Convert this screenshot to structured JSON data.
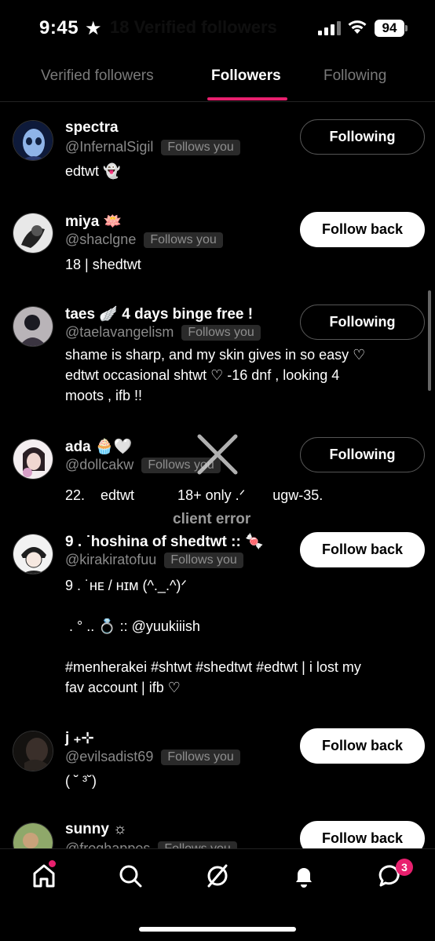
{
  "status_bar": {
    "time": "9:45",
    "battery": "94"
  },
  "header_ghost": "18 Verified followers",
  "tabs": [
    {
      "label": "Verified followers"
    },
    {
      "label": "Followers"
    },
    {
      "label": "Following"
    }
  ],
  "followers": [
    {
      "name": "spectra",
      "handle": "@InfernalSigil",
      "badge": "Follows you",
      "bio": "edtwt 👻",
      "button": "Following"
    },
    {
      "name": "miya 🪷",
      "handle": "@shaclgne",
      "badge": "Follows you",
      "bio": "18 | shedtwt",
      "button": "Follow back"
    },
    {
      "name": "taes 🪽 4 days binge free !",
      "handle": "@taelavangelism",
      "badge": "Follows you",
      "bio": "shame is sharp, and my skin gives in so easy ♡\nedtwt occasional shtwt ♡ -16 dnf , looking 4\nmoots , ifb !!",
      "button": "Following"
    },
    {
      "name": "ada 🧁🤍",
      "handle": "@dollcakw",
      "badge": "Follows you",
      "bio": "22.    edtwt           18+ only .ᐟ       ugw-35.",
      "button": "Following"
    },
    {
      "name": "9 . ˙hoshina of shedtwt :: 🍬",
      "handle": "@kirakiratofuu",
      "badge": "Follows you",
      "bio": "9 . ˙ʜᴇ / ʜɪᴍ (^._.^)ᐟ\n\n . ° .. 💍 :: @yuukiiish\n\n#menherakei #shtwt #shedtwt #edtwt | i lost my\nfav account | ifb ♡",
      "button": "Follow back"
    },
    {
      "name": "j ₊⊹",
      "handle": "@evilsadist69",
      "badge": "Follows you",
      "bio": "( ˘ ³˘)",
      "button": "Follow back"
    },
    {
      "name": "sunny ☼",
      "handle": "@froghappes",
      "badge": "Follows you",
      "bio": "",
      "button": "Follow back"
    }
  ],
  "error_text": "client error",
  "nav": {
    "items": [
      "home-icon",
      "search-icon",
      "grok-icon",
      "bell-icon",
      "messages-icon"
    ],
    "messages_count": "3"
  },
  "colors": {
    "accent": "#e8206e",
    "background": "#000000"
  }
}
